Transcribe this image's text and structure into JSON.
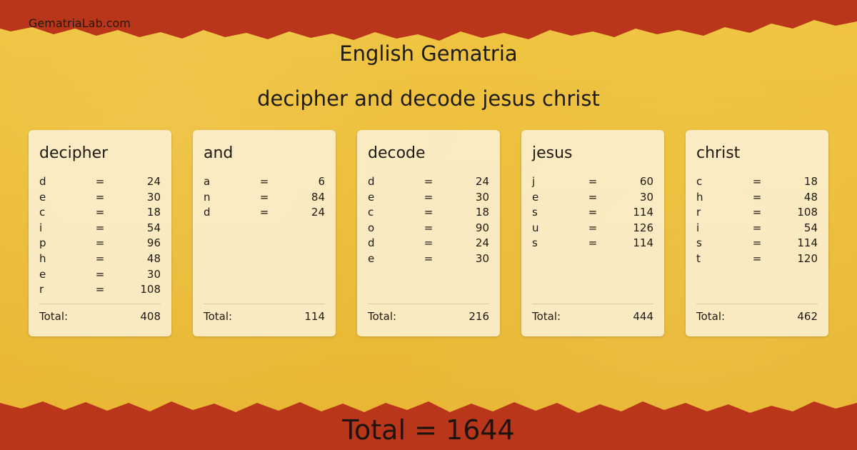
{
  "site": {
    "name": "GematriaLab.com"
  },
  "header": {
    "title": "English Gematria",
    "phrase": "decipher and decode jesus christ"
  },
  "cards": [
    {
      "word": "decipher",
      "letters": [
        {
          "l": "d",
          "v": "24"
        },
        {
          "l": "e",
          "v": "30"
        },
        {
          "l": "c",
          "v": "18"
        },
        {
          "l": "i",
          "v": "54"
        },
        {
          "l": "p",
          "v": "96"
        },
        {
          "l": "h",
          "v": "48"
        },
        {
          "l": "e",
          "v": "30"
        },
        {
          "l": "r",
          "v": "108"
        }
      ],
      "total_label": "Total:",
      "total": "408"
    },
    {
      "word": "and",
      "letters": [
        {
          "l": "a",
          "v": "6"
        },
        {
          "l": "n",
          "v": "84"
        },
        {
          "l": "d",
          "v": "24"
        }
      ],
      "total_label": "Total:",
      "total": "114"
    },
    {
      "word": "decode",
      "letters": [
        {
          "l": "d",
          "v": "24"
        },
        {
          "l": "e",
          "v": "30"
        },
        {
          "l": "c",
          "v": "18"
        },
        {
          "l": "o",
          "v": "90"
        },
        {
          "l": "d",
          "v": "24"
        },
        {
          "l": "e",
          "v": "30"
        }
      ],
      "total_label": "Total:",
      "total": "216"
    },
    {
      "word": "jesus",
      "letters": [
        {
          "l": "j",
          "v": "60"
        },
        {
          "l": "e",
          "v": "30"
        },
        {
          "l": "s",
          "v": "114"
        },
        {
          "l": "u",
          "v": "126"
        },
        {
          "l": "s",
          "v": "114"
        }
      ],
      "total_label": "Total:",
      "total": "444"
    },
    {
      "word": "christ",
      "letters": [
        {
          "l": "c",
          "v": "18"
        },
        {
          "l": "h",
          "v": "48"
        },
        {
          "l": "r",
          "v": "108"
        },
        {
          "l": "i",
          "v": "54"
        },
        {
          "l": "s",
          "v": "114"
        },
        {
          "l": "t",
          "v": "120"
        }
      ],
      "total_label": "Total:",
      "total": "462"
    }
  ],
  "equals_sign": "=",
  "footer": {
    "grand_total": "Total = 1644"
  },
  "colors": {
    "border_red": "#b9361a",
    "parchment": "#edbe38",
    "card": "#fcf0d4"
  }
}
